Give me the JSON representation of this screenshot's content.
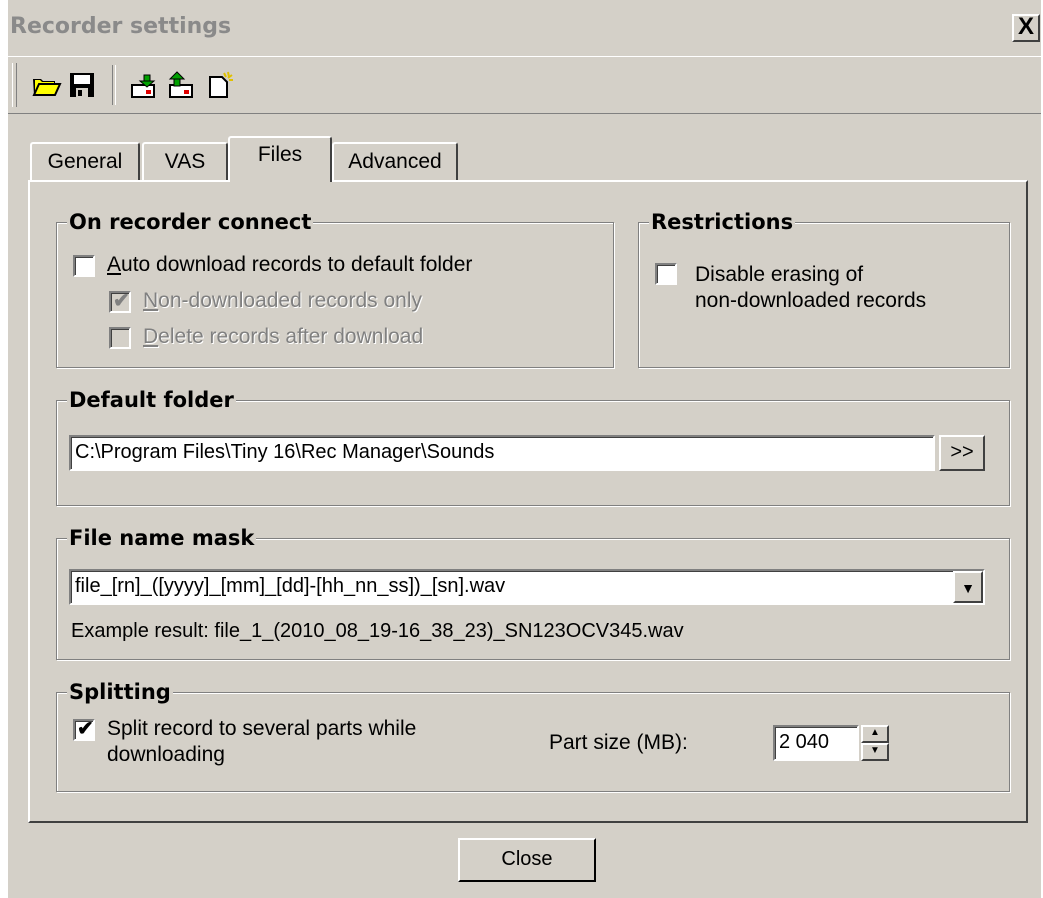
{
  "window": {
    "title": "Recorder settings",
    "close_glyph": "X"
  },
  "toolbar": {
    "buttons": [
      {
        "icon": "open-folder-icon"
      },
      {
        "icon": "save-disk-icon"
      },
      {
        "icon": "download-from-recorder-icon"
      },
      {
        "icon": "upload-to-recorder-icon"
      },
      {
        "icon": "new-document-icon"
      }
    ]
  },
  "tabs": {
    "general": "General",
    "vas": "VAS",
    "files": "Files",
    "advanced": "Advanced",
    "active": "Files"
  },
  "on_connect": {
    "title": "On recorder connect",
    "auto_download_prefix": "A",
    "auto_download_rest": "uto download records to default folder",
    "auto_download_checked": false,
    "non_downloaded_prefix": "N",
    "non_downloaded_rest": "on-downloaded records only",
    "non_downloaded_checked": true,
    "delete_prefix": "D",
    "delete_rest": "elete records after download",
    "delete_checked": false
  },
  "restrictions": {
    "title": "Restrictions",
    "disable_erasing_line1": "Disable erasing of",
    "disable_erasing_line2": "non-downloaded records",
    "disable_erasing_checked": false
  },
  "default_folder": {
    "title": "Default folder",
    "path": "C:\\Program Files\\Tiny 16\\Rec Manager\\Sounds",
    "browse_label": ">>"
  },
  "file_name_mask": {
    "title": "File name mask",
    "value": "file_[rn]_([yyyy]_[mm]_[dd]-[hh_nn_ss])_[sn].wav",
    "example": "Example result: file_1_(2010_08_19-16_38_23)_SN123OCV345.wav"
  },
  "splitting": {
    "title": "Splitting",
    "split_line1": "Split record to several parts while",
    "split_line2": "downloading",
    "split_checked": true,
    "part_size_label": "Part size (MB):",
    "part_size_value": "2 040"
  },
  "footer": {
    "close_label": "Close"
  },
  "colors": {
    "face": "#d4d0c8",
    "shadow": "#808080",
    "title_text": "#8a8a8a"
  }
}
